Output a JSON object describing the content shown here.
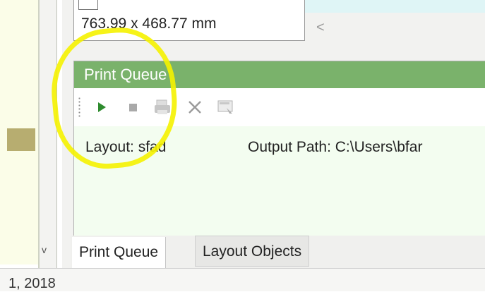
{
  "dimensions": {
    "value": "763.99 x 468.77 mm"
  },
  "scroll_left_arrow": "<",
  "left_scroll_arrow": "v",
  "print_queue_panel": {
    "title": "Print Queue",
    "toolbar": [
      {
        "name": "play-icon",
        "color": "#2e8b2e"
      },
      {
        "name": "stop-icon",
        "color": "#9a9a9a"
      },
      {
        "name": "printer-icon",
        "color": "#b9b9b9"
      },
      {
        "name": "delete-icon",
        "color": "#9a9a9a"
      },
      {
        "name": "properties-icon",
        "color": "#b0b0b0"
      }
    ],
    "row": {
      "layout": "Layout: sfad",
      "output_path": "Output Path: C:\\Users\\bfar"
    }
  },
  "tabs": [
    {
      "label": "Print Queue",
      "active": true
    },
    {
      "label": "Layout Objects",
      "active": false
    }
  ],
  "bottom_text": "1, 2018",
  "colors": {
    "panel_header": "#7ab26b",
    "queue_background": "#f3fdf0",
    "highlight": "#f5f200"
  }
}
